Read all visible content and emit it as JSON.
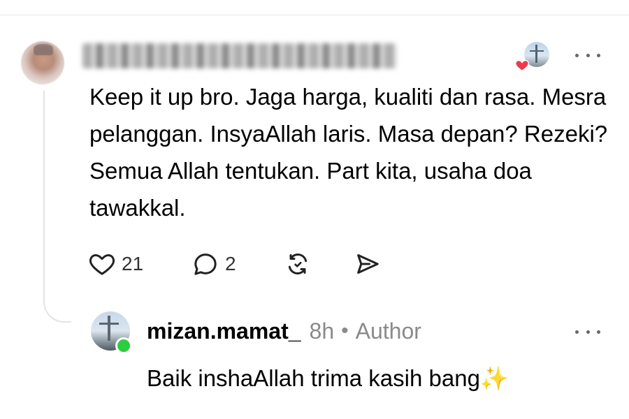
{
  "comment": {
    "text": "Keep it up bro. Jaga harga, kualiti dan rasa. Mesra pelanggan. InsyaAllah laris. Masa depan? Rezeki? Semua Allah tentukan. Part kita, usaha doa tawakkal.",
    "likes": "21",
    "replies": "2",
    "liked_by_author": true,
    "icons": {
      "like": "heart-icon",
      "reply": "reply-bubble-icon",
      "repost": "repost-icon",
      "share": "share-send-icon",
      "more": "more-icon"
    }
  },
  "reply": {
    "username": "mizan.mamat_",
    "time": "8h",
    "separator": "•",
    "badge": "Author",
    "text": "Baik inshaAllah trima kasih bang",
    "emoji": "✨",
    "online": true
  },
  "colors": {
    "heart_badge": "#ee3a4a",
    "online_dot": "#2ecc40",
    "muted_text": "#8a8a8a",
    "thread_line": "#e4e4e4"
  }
}
